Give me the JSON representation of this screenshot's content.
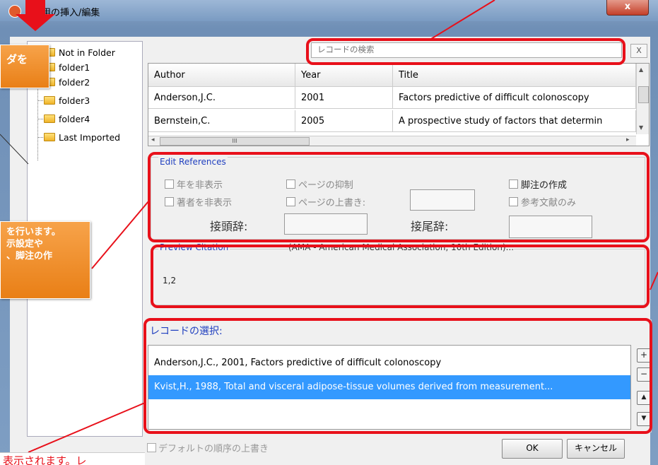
{
  "window": {
    "title": "引用の挿入/編集",
    "close_label": "x"
  },
  "folders": [
    {
      "name": "Not in Folder"
    },
    {
      "name": "folder1"
    },
    {
      "name": "folder2"
    },
    {
      "name": "folder3"
    },
    {
      "name": "folder4"
    },
    {
      "name": "Last Imported"
    }
  ],
  "search": {
    "placeholder": "レコードの検索",
    "clear_label": "X"
  },
  "grid": {
    "columns": [
      "Author",
      "Year",
      "Title"
    ],
    "rows": [
      {
        "author": "Anderson,J.C.",
        "year": "2001",
        "title": "Factors predictive of difficult colonoscopy"
      },
      {
        "author": "Bernstein,C.",
        "year": "2005",
        "title": "A prospective study of factors that determin"
      }
    ],
    "hscroll_thumb": "III"
  },
  "edit": {
    "legend": "Edit References",
    "hide_year": "年を非表示",
    "hide_author": "著者を非表示",
    "suppress_pages": "ページの抑制",
    "override_pages": "ページの上書き:",
    "make_footnote": "脚注の作成",
    "bibliography_only": "参考文献のみ",
    "prefix_label": "接頭辞:",
    "suffix_label": "接尾辞:"
  },
  "preview": {
    "legend": "Preview Citation",
    "style": "(AMA - American Medical Association, 10th Edition)...",
    "text": "1,2"
  },
  "selection": {
    "legend": "レコードの選択:",
    "items": [
      "Anderson,J.C., 2001, Factors predictive of difficult colonoscopy",
      "Kvist,H., 1988, Total and visceral adipose-tissue volumes derived from measurement..."
    ],
    "selected_index": 1,
    "buttons": [
      "+",
      "−",
      "▲",
      "▼"
    ]
  },
  "footer": {
    "override_order": "デフォルトの順序の上書き",
    "ok_label": "OK",
    "cancel_label": "キャンセル"
  },
  "annotations": {
    "callout_top": "ダを",
    "callout_mid": [
      "を行います。",
      "示設定や",
      "、脚注の作"
    ],
    "bottom_note": "表示されます。レ"
  },
  "colors": {
    "highlight": "#e8101a",
    "selection": "#3399ff",
    "callout": "#e97f16",
    "legend_text": "#1f3fbf"
  }
}
